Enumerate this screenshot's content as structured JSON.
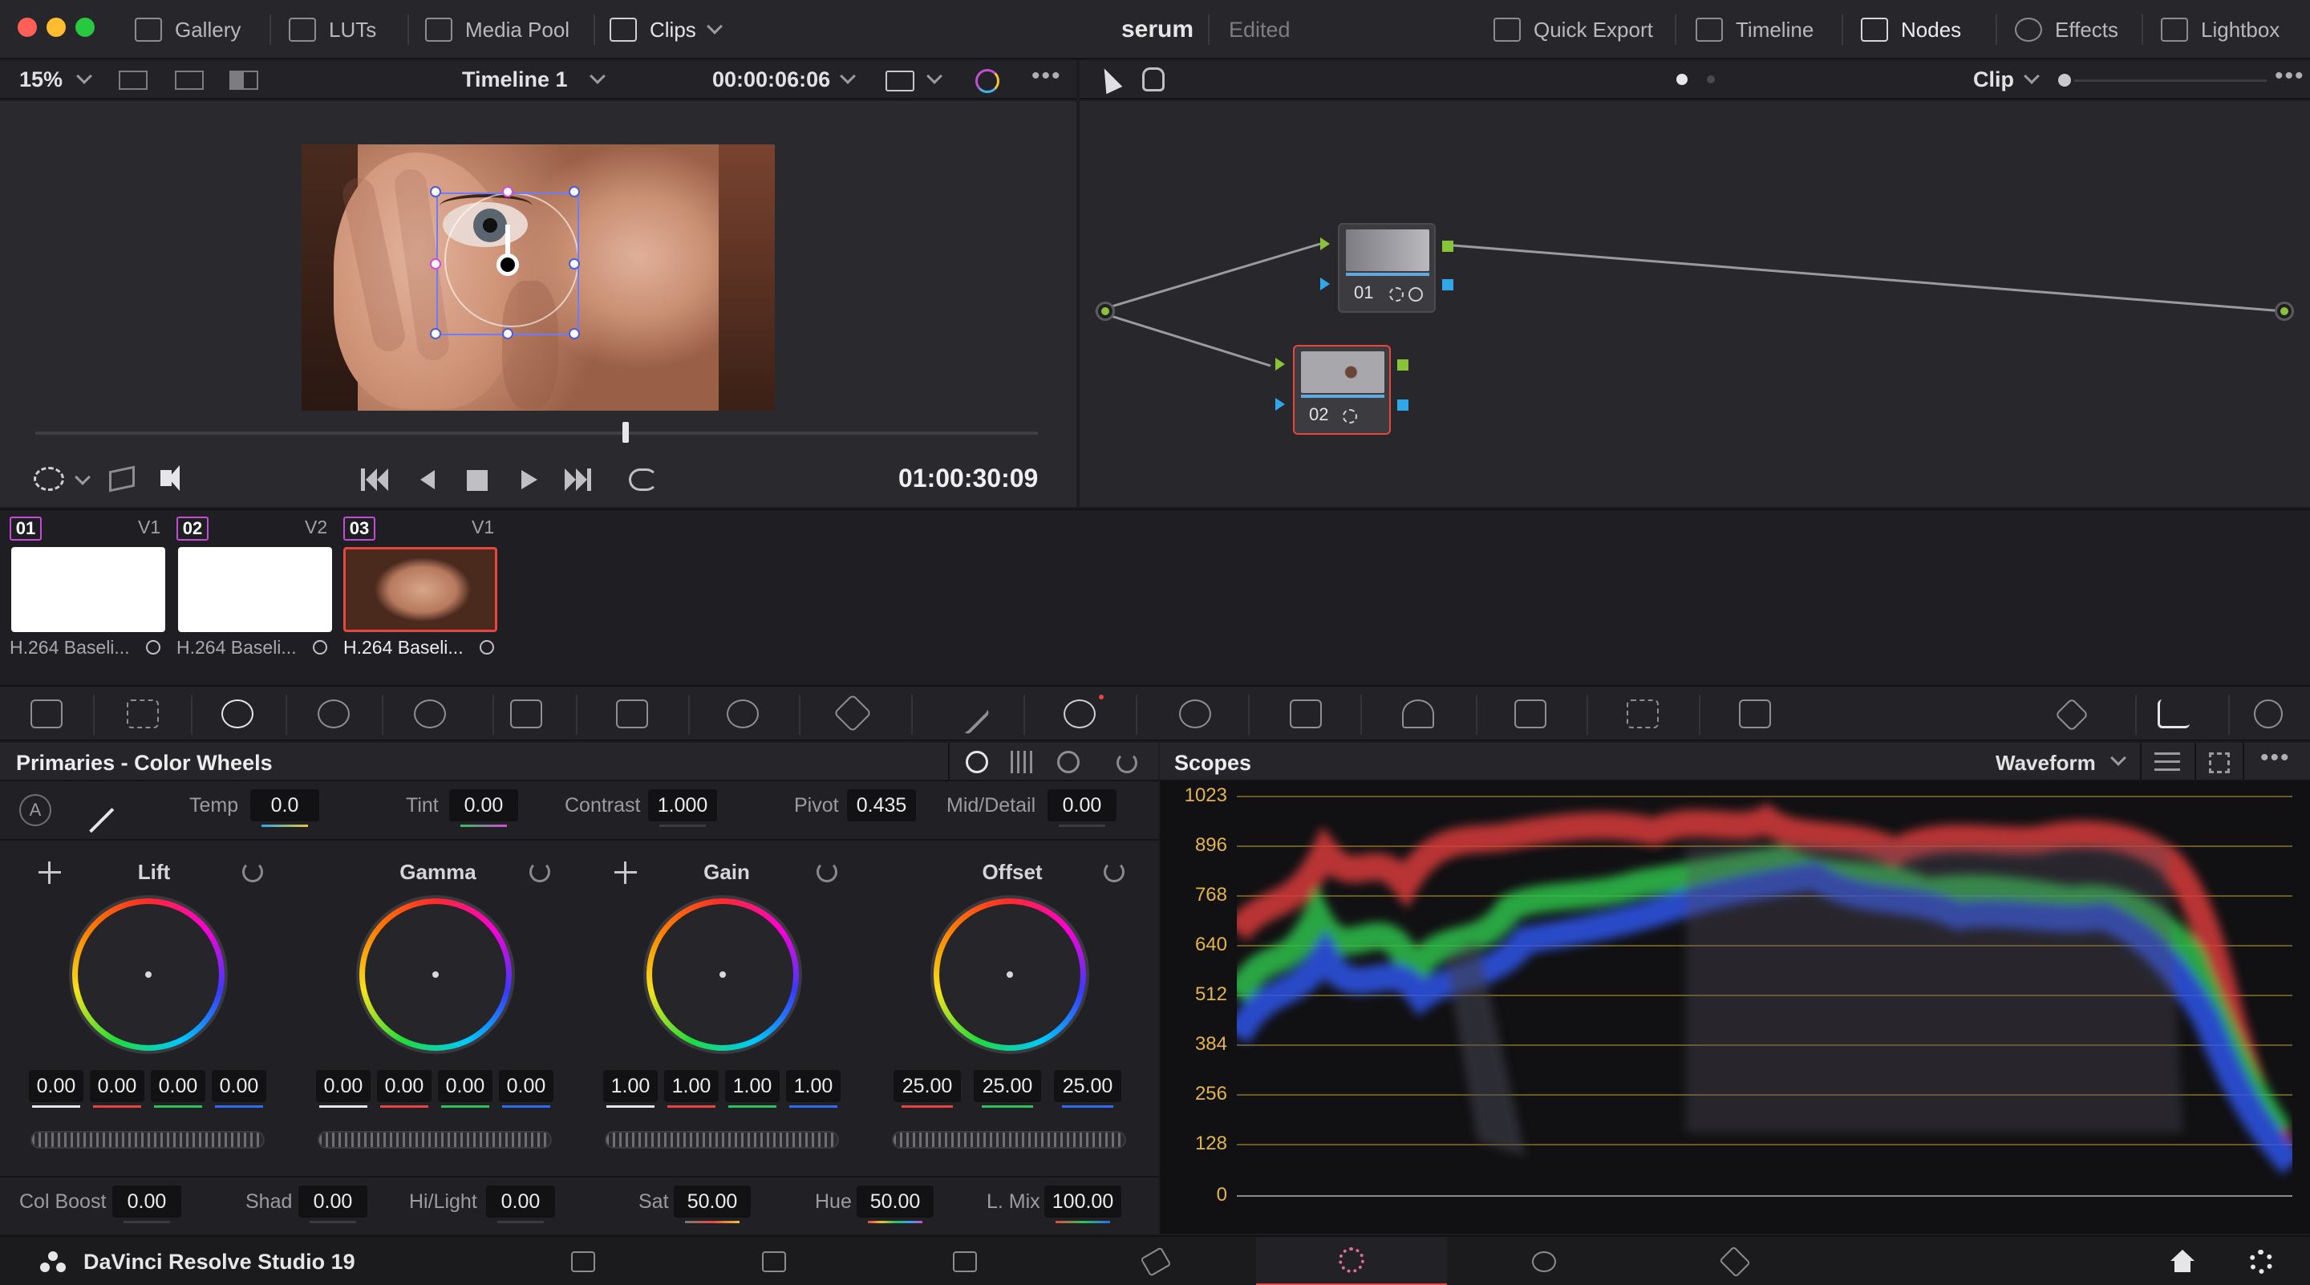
{
  "titlebar": {
    "left_items": [
      "Gallery",
      "LUTs",
      "Media Pool",
      "Clips"
    ],
    "project_name": "serum",
    "project_status": "Edited",
    "right_items": [
      "Quick Export",
      "Timeline",
      "Nodes",
      "Effects",
      "Lightbox"
    ]
  },
  "viewer": {
    "zoom": "15%",
    "timeline_name": "Timeline 1",
    "source_timecode": "00:00:06:06",
    "record_timecode": "01:00:30:09"
  },
  "node_editor": {
    "mode": "Clip",
    "nodes": [
      {
        "label": "01",
        "selected": false
      },
      {
        "label": "02",
        "selected": true
      }
    ]
  },
  "clips": [
    {
      "number": "01",
      "track": "V1",
      "name": "H.264 Baseli...",
      "color": "#c64bd4"
    },
    {
      "number": "02",
      "track": "V2",
      "name": "H.264 Baseli...",
      "color": "#c64bd4"
    },
    {
      "number": "03",
      "track": "V1",
      "name": "H.264 Baseli...",
      "color": "#c64bd4"
    }
  ],
  "primaries": {
    "title": "Primaries - Color Wheels",
    "params_top": [
      {
        "label": "Temp",
        "value": "0.0"
      },
      {
        "label": "Tint",
        "value": "0.00"
      },
      {
        "label": "Contrast",
        "value": "1.000"
      },
      {
        "label": "Pivot",
        "value": "0.435"
      },
      {
        "label": "Mid/Detail",
        "value": "0.00"
      }
    ],
    "wheels": [
      {
        "name": "Lift",
        "values": [
          "0.00",
          "0.00",
          "0.00",
          "0.00"
        ]
      },
      {
        "name": "Gamma",
        "values": [
          "0.00",
          "0.00",
          "0.00",
          "0.00"
        ]
      },
      {
        "name": "Gain",
        "values": [
          "1.00",
          "1.00",
          "1.00",
          "1.00"
        ]
      },
      {
        "name": "Offset",
        "values": [
          "25.00",
          "25.00",
          "25.00"
        ]
      }
    ],
    "params_bottom": [
      {
        "label": "Col Boost",
        "value": "0.00"
      },
      {
        "label": "Shad",
        "value": "0.00"
      },
      {
        "label": "Hi/Light",
        "value": "0.00"
      },
      {
        "label": "Sat",
        "value": "50.00"
      },
      {
        "label": "Hue",
        "value": "50.00"
      },
      {
        "label": "L. Mix",
        "value": "100.00"
      }
    ]
  },
  "scopes": {
    "title": "Scopes",
    "mode": "Waveform",
    "scale": [
      "1023",
      "896",
      "768",
      "640",
      "512",
      "384",
      "256",
      "128",
      "0"
    ]
  },
  "app": {
    "name": "DaVinci Resolve Studio 19"
  },
  "colors": {
    "accent_red": "#e5473f",
    "node_green": "#88c33a",
    "node_blue": "#2fa7e8",
    "scope_scale": "#e3b448"
  }
}
